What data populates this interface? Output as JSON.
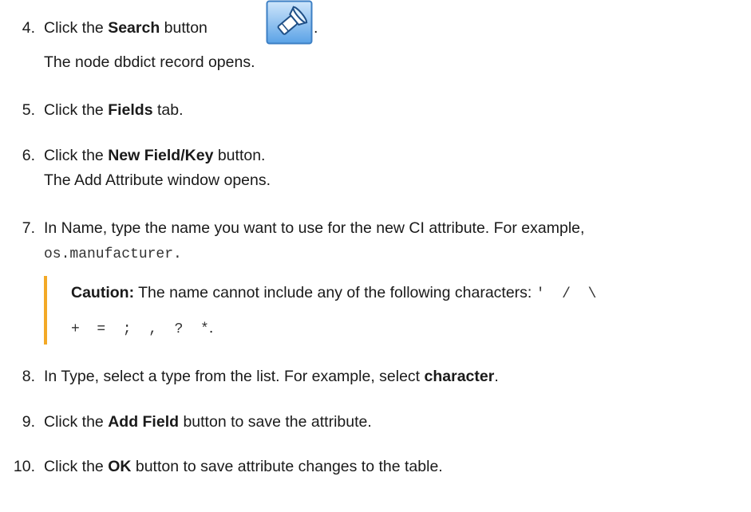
{
  "steps": [
    {
      "num": "4.",
      "pre": "Click the ",
      "bold": "Search",
      "post": " button",
      "after_icon": ".",
      "sub": "The node dbdict record opens."
    },
    {
      "num": "5.",
      "pre": "Click the ",
      "bold": "Fields",
      "post": " tab."
    },
    {
      "num": "6.",
      "pre": "Click the ",
      "bold": "New Field/Key",
      "post": " button.",
      "sub": "The Add Attribute window opens."
    },
    {
      "num": "7.",
      "text": "In Name, type the name you want to use for the new CI attribute. For example,",
      "code": "os.manufacturer."
    },
    {
      "num": "8.",
      "pre": "In Type, select a type from the list. For example, select ",
      "bold": "character",
      "post": "."
    },
    {
      "num": "9.",
      "pre": "Click the ",
      "bold": "Add Field",
      "post": " button to save the attribute."
    },
    {
      "num": "10.",
      "pre": "Click the ",
      "bold": "OK",
      "post": " button to save attribute changes to the table."
    }
  ],
  "caution": {
    "label": "Caution:",
    "text": " The name cannot include any of the following characters: ",
    "chars1": "'  /  \\",
    "chars2": "+  =  ;  ,  ?  *",
    "end": "."
  },
  "icons": {
    "search": "flashlight-search-icon"
  }
}
